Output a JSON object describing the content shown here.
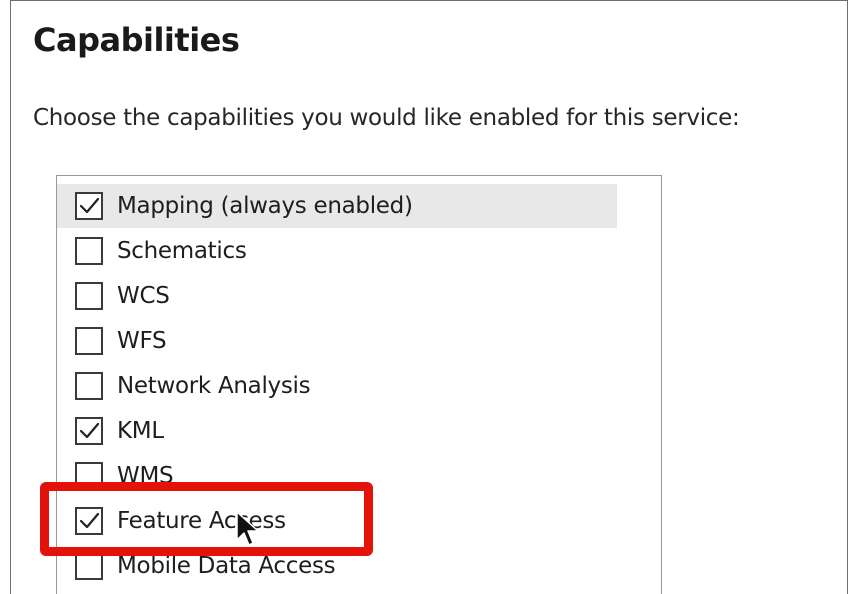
{
  "section": {
    "heading": "Capabilities",
    "instructions": "Choose the capabilities you would like enabled for this service:"
  },
  "capabilities": [
    {
      "label": "Mapping (always enabled)",
      "checked": true,
      "selected": true
    },
    {
      "label": "Schematics",
      "checked": false,
      "selected": false
    },
    {
      "label": "WCS",
      "checked": false,
      "selected": false
    },
    {
      "label": "WFS",
      "checked": false,
      "selected": false
    },
    {
      "label": "Network Analysis",
      "checked": false,
      "selected": false
    },
    {
      "label": "KML",
      "checked": true,
      "selected": false
    },
    {
      "label": "WMS",
      "checked": false,
      "selected": false
    },
    {
      "label": "Feature Access",
      "checked": true,
      "selected": false,
      "highlighted": true
    },
    {
      "label": "Mobile Data Access",
      "checked": false,
      "selected": false
    }
  ],
  "colors": {
    "highlight": "#e3120b",
    "selected_row": "#e8e8e8",
    "checkbox_border": "#3a3a3a"
  },
  "icons": {
    "checkmark": "checkmark-icon",
    "cursor": "mouse-pointer-icon"
  }
}
